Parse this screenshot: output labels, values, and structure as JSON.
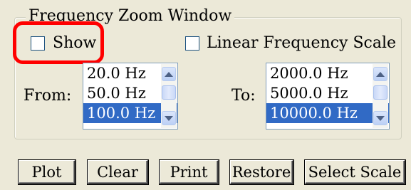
{
  "group": {
    "title": "Frequency Zoom Window"
  },
  "show_checkbox": {
    "label": "Show",
    "checked": false
  },
  "linear_checkbox": {
    "label": "Linear Frequency Scale",
    "checked": false
  },
  "from": {
    "label": "From:",
    "items": [
      "20.0 Hz",
      "50.0 Hz",
      "100.0 Hz"
    ],
    "selected": "100.0 Hz"
  },
  "to": {
    "label": "To:",
    "items": [
      "2000.0 Hz",
      "5000.0 Hz",
      "10000.0 Hz"
    ],
    "selected": "10000.0 Hz"
  },
  "buttons": {
    "plot": "Plot",
    "clear": "Clear",
    "print": "Print",
    "restore": "Restore",
    "select_scale": "Select Scale"
  },
  "colors": {
    "highlight": "#ff0000",
    "selection": "#316ac5"
  },
  "icons": {
    "scroll_up": "chevron-up-icon",
    "scroll_down": "chevron-down-icon"
  }
}
